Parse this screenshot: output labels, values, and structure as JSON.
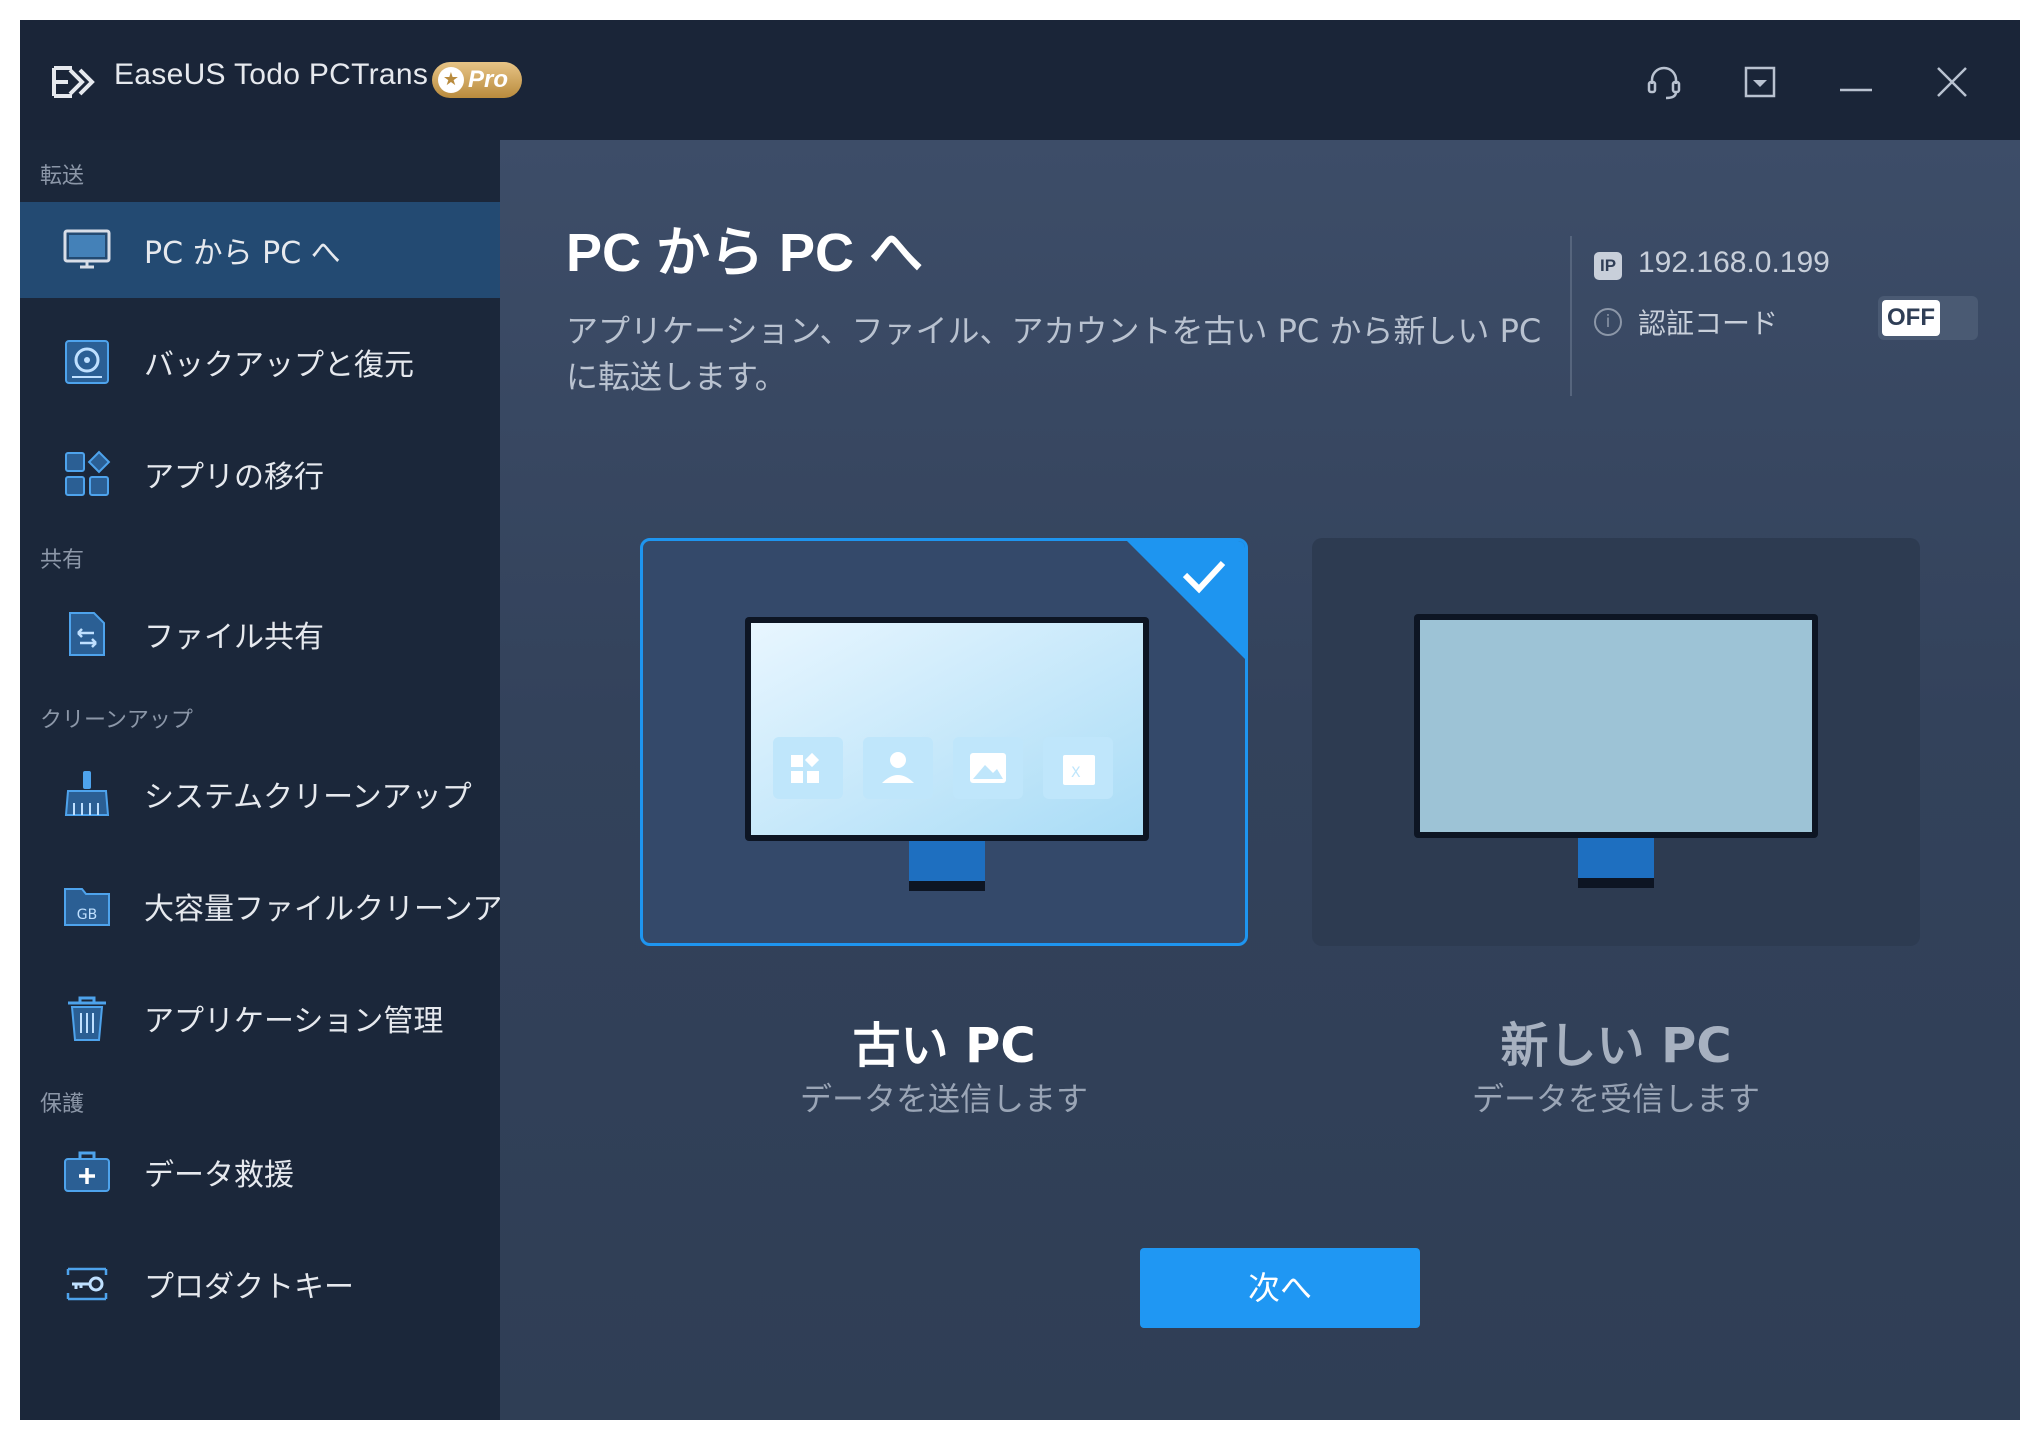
{
  "titlebar": {
    "app_title": "EaseUS Todo PCTrans",
    "badge": "Pro",
    "buttons": [
      "headset-icon",
      "dropdown-icon",
      "minimize-icon",
      "close-icon"
    ]
  },
  "sidebar": {
    "sections": {
      "transfer": "転送",
      "share": "共有",
      "cleanup": "クリーンアップ",
      "protect": "保護"
    },
    "items": [
      {
        "label": "PC から PC へ",
        "icon": "monitor-icon",
        "active": true
      },
      {
        "label": "バックアップと復元",
        "icon": "backup-icon",
        "active": false
      },
      {
        "label": "アプリの移行",
        "icon": "apps-icon",
        "active": false
      },
      {
        "label": "ファイル共有",
        "icon": "file-share-icon",
        "active": false
      },
      {
        "label": "システムクリーンアップ",
        "icon": "broom-icon",
        "active": false
      },
      {
        "label": "大容量ファイルクリーンアップ",
        "icon": "gb-folder-icon",
        "active": false
      },
      {
        "label": "アプリケーション管理",
        "icon": "trash-icon",
        "active": false
      },
      {
        "label": "データ救援",
        "icon": "rescue-kit-icon",
        "active": false
      },
      {
        "label": "プロダクトキー",
        "icon": "key-icon",
        "active": false
      }
    ]
  },
  "main": {
    "title": "PC から PC へ",
    "description": "アプリケーション、ファイル、アカウントを古い PC から新しい PC に転送します。",
    "ip_badge": "IP",
    "ip": "192.168.0.199",
    "auth_label": "認証コード",
    "auth_toggle": "OFF",
    "cards": [
      {
        "title": "古い PC",
        "subtitle": "データを送信します",
        "selected": true
      },
      {
        "title": "新しい PC",
        "subtitle": "データを受信します",
        "selected": false
      }
    ],
    "next_button": "次へ"
  },
  "colors": {
    "accent": "#1f97f3",
    "titlebar": "#1a2538",
    "sidebar": "#1b273a",
    "active_item": "#234a72",
    "main_bg": "#33425b"
  }
}
